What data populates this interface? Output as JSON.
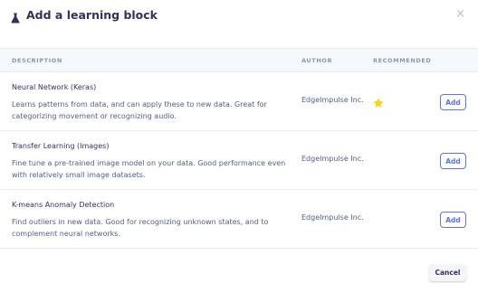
{
  "dialog": {
    "title": "Add a learning block",
    "close_glyph": "×",
    "icons": {
      "title": "flask-icon",
      "close": "close-icon",
      "recommended": "star-icon"
    }
  },
  "table": {
    "columns": {
      "description": "DESCRIPTION",
      "author": "AUTHOR",
      "recommended": "RECOMMENDED"
    },
    "rows": [
      {
        "name": "Neural Network (Keras)",
        "description": "Learns patterns from data, and can apply these to new data. Great for categorizing movement or recognizing audio.",
        "author": "EdgeImpulse Inc.",
        "recommended": true,
        "action": "Add"
      },
      {
        "name": "Transfer Learning (Images)",
        "description": "Fine tune a pre-trained image model on your data. Good performance even with relatively small image datasets.",
        "author": "EdgeImpulse Inc.",
        "recommended": false,
        "action": "Add"
      },
      {
        "name": "K-means Anomaly Detection",
        "description": "Find outliers in new data. Good for recognizing unknown states, and to complement neural networks.",
        "author": "EdgeImpulse Inc.",
        "recommended": false,
        "action": "Add"
      }
    ]
  },
  "footer": {
    "cancel_label": "Cancel"
  },
  "colors": {
    "accent": "#5e72e4",
    "star": "#ffd600",
    "header_bg": "#f6f9fc",
    "text": "#32325d"
  }
}
